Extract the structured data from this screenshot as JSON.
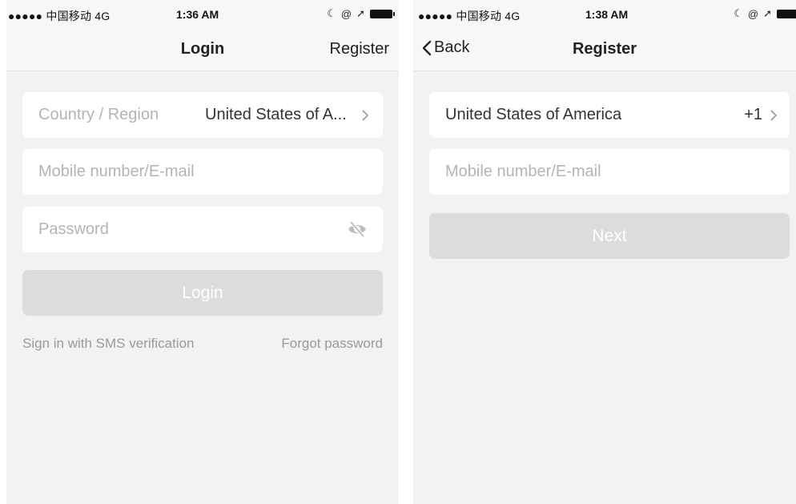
{
  "login_screen": {
    "status": {
      "carrier": "●●●●● 中国移动  4G",
      "time": "1:36 AM"
    },
    "nav": {
      "title": "Login",
      "right_action": "Register"
    },
    "country_field": {
      "label": "Country / Region",
      "value": "United States of A..."
    },
    "account_field": {
      "placeholder": "Mobile number/E-mail"
    },
    "password_field": {
      "placeholder": "Password"
    },
    "login_button": "Login",
    "sms_link": "Sign in with SMS verification",
    "forgot_link": "Forgot password"
  },
  "register_screen": {
    "status": {
      "carrier": "●●●●● 中国移动  4G",
      "time": "1:38 AM"
    },
    "nav": {
      "back": "Back",
      "title": "Register"
    },
    "country_field": {
      "value": "United States of America",
      "code": "+1"
    },
    "account_field": {
      "placeholder": "Mobile number/E-mail"
    },
    "next_button": "Next"
  },
  "colors": {
    "background": "#f2f2f2",
    "field_bg": "#ffffff",
    "placeholder": "#b4b4b4",
    "disabled_button": "#dcdcdc",
    "link": "#9a9a9a"
  },
  "icons": [
    "moon-icon",
    "location-lock-icon",
    "location-arrow-icon",
    "battery-icon",
    "chevron-right-icon",
    "eye-slash-icon",
    "chevron-left-icon"
  ]
}
